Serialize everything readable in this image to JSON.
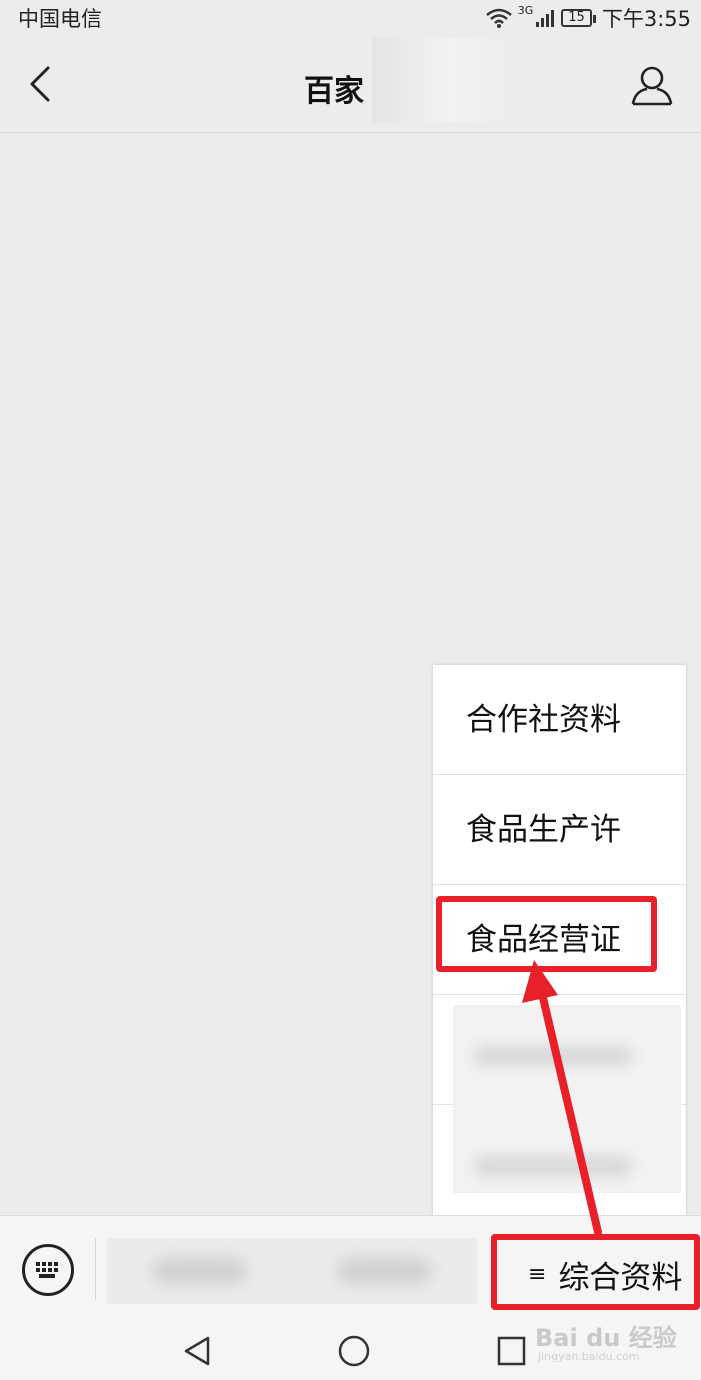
{
  "status_bar": {
    "carrier": "中国电信",
    "network": "3G",
    "battery": "15",
    "time": "下午3:55"
  },
  "nav": {
    "title": "百家",
    "back_icon": "chevron-left-icon",
    "profile_icon": "person-icon"
  },
  "popup_menu": {
    "items": [
      {
        "label": "合作社资料"
      },
      {
        "label": "食品生产许"
      },
      {
        "label": "食品经营证"
      }
    ]
  },
  "bottom_bar": {
    "menu_tab_glyph": "≡",
    "menu_tab_label": "综合资料"
  },
  "watermark": {
    "brand": "Bai du 经验",
    "url": "jingyan.baidu.com"
  },
  "colors": {
    "annotation": "#e8202a",
    "background": "#ececec"
  }
}
